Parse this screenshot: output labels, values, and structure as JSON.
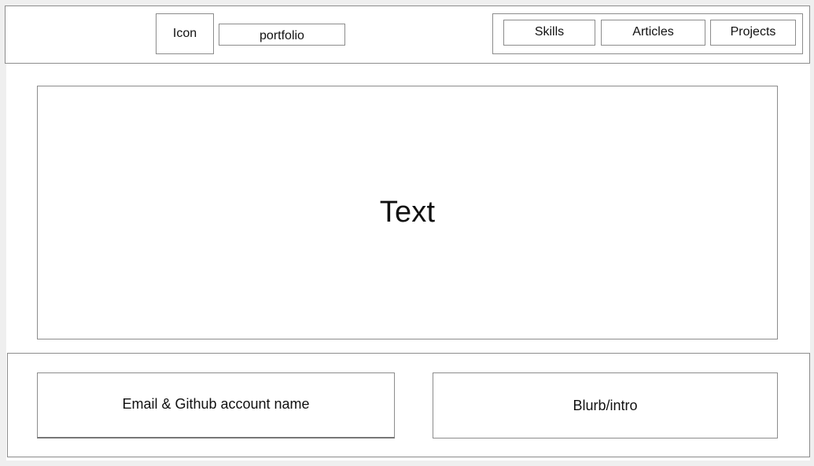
{
  "header": {
    "icon_label": "Icon",
    "portfolio_label": "portfolio",
    "nav": {
      "skills": "Skills",
      "articles": "Articles",
      "projects": "Projects"
    }
  },
  "hero": {
    "text": "Text"
  },
  "footer": {
    "contact_text": "Email & Github account name",
    "intro_text": "Blurb/intro"
  },
  "colors": {
    "background": "#efefef",
    "surface": "#ffffff",
    "border": "#8c8c8c",
    "text": "#111111"
  }
}
